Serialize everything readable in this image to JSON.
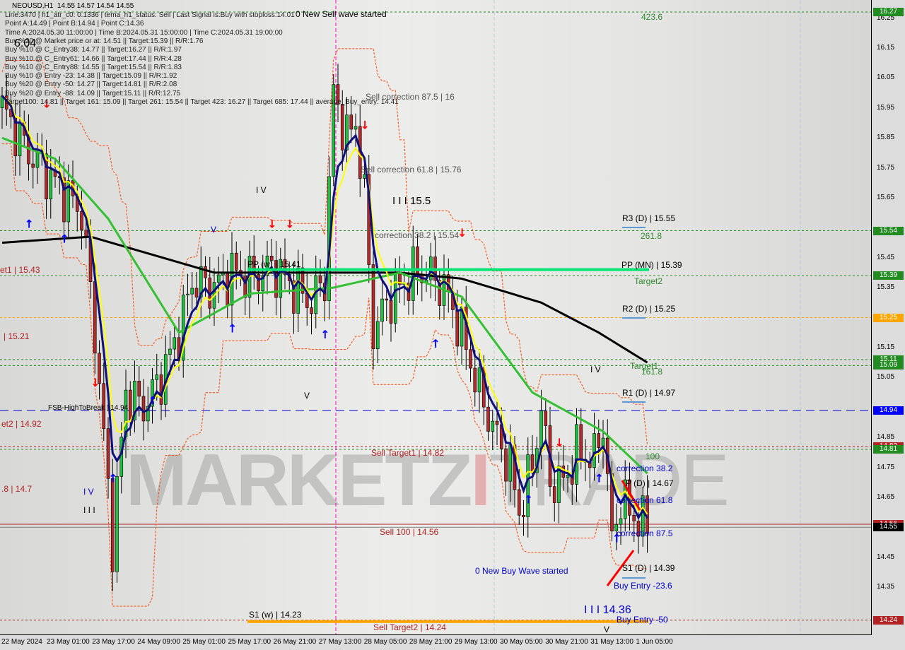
{
  "header": {
    "symbol": "NEOUSD,H1",
    "ohlc": "14.55 14.57 14.54 14.55"
  },
  "info_lines": [
    "Line:3470 | h1_atr_c0: 0.1336 | tema_h1_status: Sell | Last Signal is:Buy with stoploss:14.01",
    "Point A:14.49 | Point B:14.94 | Point C:14.36",
    "Time A:2024.05.30 11:00:00 | Time B:2024.05.31 15:00:00 | Time C:2024.05.31 19:00:00",
    "Buy %20 @ Market price or at: 14.51 || Target:15.39 || R/R:1.76",
    "Buy %10 @ C_Entry38: 14.77 || Target:16.27 || R/R:1.97",
    "Buy %10 @ C_Entry61: 14.66 || Target:17.44 || R/R:4.28",
    "Buy %10 @ C_Entry88: 14.55 || Target:15.54 || R/R:1.83",
    "Buy %10 @ Entry -23: 14.38 || Target:15.09 || R/R:1.92",
    "Buy %20 @ Entry -50: 14.27 || Target:14.81 || R/R:2.08",
    "Buy %20 @ Entry -88: 14.09 || Target:15.11 || R/R:12.75",
    "Target100: 14.81 || Target 161: 15.09 || Target 261: 15.54 || Target 423: 16.27 || Target 685: 17.44 || average_Buy_entry: 14.41"
  ],
  "watermark": {
    "bold": "MARKETZ",
    "thin": "TRADE",
    "mid": "I"
  },
  "colors": {
    "bull": "#1fbf3f",
    "bear": "#b22a2a",
    "ma_black": "#000000",
    "ma_green": "#33c033",
    "ma_navy": "#10107a",
    "ma_yellow": "#ffff00",
    "pp_line": "#00e676",
    "channel": "#ff4500"
  },
  "chart_data": {
    "type": "candlestick",
    "timeframe": "H1",
    "ylim": [
      14.22,
      16.31
    ],
    "yticks": [
      16.25,
      16.15,
      16.05,
      15.95,
      15.85,
      15.75,
      15.65,
      15.45,
      15.35,
      15.15,
      15.05,
      14.85,
      14.75,
      14.65,
      14.45,
      14.35
    ],
    "xticks": [
      "22 May 2024",
      "23 May 01:00",
      "23 May 17:00",
      "24 May 09:00",
      "25 May 01:00",
      "25 May 17:00",
      "26 May 21:00",
      "27 May 13:00",
      "28 May 05:00",
      "28 May 21:00",
      "29 May 13:00",
      "30 May 05:00",
      "30 May 21:00",
      "31 May 13:00",
      "1 Jun 05:00"
    ],
    "close_path": [
      [
        0,
        15.95
      ],
      [
        6,
        15.8
      ],
      [
        12,
        15.7
      ],
      [
        18,
        15.6
      ],
      [
        21,
        15.2
      ],
      [
        23,
        14.85
      ],
      [
        25,
        14.5
      ],
      [
        28,
        15.0
      ],
      [
        32,
        14.95
      ],
      [
        36,
        15.05
      ],
      [
        40,
        15.2
      ],
      [
        43,
        15.37
      ],
      [
        48,
        15.35
      ],
      [
        52,
        15.4
      ],
      [
        57,
        15.38
      ],
      [
        61,
        15.42
      ],
      [
        66,
        15.35
      ],
      [
        70,
        15.3
      ],
      [
        73,
        15.38
      ],
      [
        75,
        16.0
      ],
      [
        78,
        15.85
      ],
      [
        80,
        15.9
      ],
      [
        82,
        15.65
      ],
      [
        84,
        15.2
      ],
      [
        87,
        15.3
      ],
      [
        90,
        15.35
      ],
      [
        93,
        15.4
      ],
      [
        96,
        15.4
      ],
      [
        100,
        15.35
      ],
      [
        104,
        15.2
      ],
      [
        108,
        15.0
      ],
      [
        112,
        14.85
      ],
      [
        115,
        14.75
      ],
      [
        117,
        14.6
      ],
      [
        120,
        14.75
      ],
      [
        122,
        14.95
      ],
      [
        124,
        14.7
      ],
      [
        127,
        14.7
      ],
      [
        130,
        14.8
      ],
      [
        134,
        14.78
      ],
      [
        136,
        14.9
      ],
      [
        138,
        14.5
      ],
      [
        140,
        14.65
      ],
      [
        142,
        14.6
      ],
      [
        145,
        14.56
      ]
    ],
    "ma_black": [
      [
        0,
        15.5
      ],
      [
        20,
        15.52
      ],
      [
        48,
        15.4
      ],
      [
        90,
        15.4
      ],
      [
        104,
        15.38
      ],
      [
        122,
        15.3
      ],
      [
        135,
        15.2
      ],
      [
        146,
        15.1
      ]
    ],
    "ma_green": [
      [
        0,
        15.85
      ],
      [
        12,
        15.78
      ],
      [
        24,
        15.58
      ],
      [
        40,
        15.2
      ],
      [
        56,
        15.33
      ],
      [
        75,
        15.35
      ],
      [
        90,
        15.4
      ],
      [
        104,
        15.32
      ],
      [
        120,
        15.0
      ],
      [
        136,
        14.87
      ],
      [
        146,
        14.73
      ]
    ],
    "horizontal_levels": [
      {
        "price": 16.27,
        "color": "#228b22",
        "style": "dash",
        "tag": "16.27"
      },
      {
        "price": 15.54,
        "color": "#228b22",
        "style": "dash",
        "tag": "15.54"
      },
      {
        "price": 15.39,
        "color": "#228b22",
        "style": "dash",
        "tag": "15.39"
      },
      {
        "price": 15.25,
        "color": "#ffa500",
        "style": "dash",
        "tag": "15.25"
      },
      {
        "price": 15.11,
        "color": "#228b22",
        "style": "dash",
        "tag": "15.11"
      },
      {
        "price": 15.09,
        "color": "#228b22",
        "style": "dash",
        "tag": "15.09"
      },
      {
        "price": 14.94,
        "color": "#0000cd",
        "style": "longdash",
        "tag": "14.94"
      },
      {
        "price": 14.82,
        "color": "#b22222",
        "style": "dash",
        "tag": "14.82"
      },
      {
        "price": 14.81,
        "color": "#228b22",
        "style": "dash",
        "tag": "14.81"
      },
      {
        "price": 14.56,
        "color": "#b22222",
        "style": "solid",
        "tag": "14.56"
      },
      {
        "price": 14.55,
        "color": "#808080",
        "style": "solid",
        "tag": "14.55"
      },
      {
        "price": 14.24,
        "color": "#b22222",
        "style": "dash",
        "tag": "14.24"
      }
    ],
    "tag_colors": {
      "16.27": "#228b22",
      "15.54": "#228b22",
      "15.39": "#228b22",
      "15.25": "#ffa500",
      "15.11": "#228b22",
      "15.09": "#228b22",
      "14.94": "#0000ff",
      "14.82": "#b22222",
      "14.81": "#228b22",
      "14.56": "#b22222",
      "14.55": "#000000",
      "14.24": "#b22222"
    },
    "pp_monthly": 15.41,
    "sell_target2": 14.24,
    "annotations": [
      {
        "text": "0 New Sell wave started",
        "color": "#000000"
      },
      {
        "text": "423.6",
        "color": "#2e8b2e"
      },
      {
        "text": "Sell correction 87.5 | 16",
        "color": "#555555"
      },
      {
        "text": "Sell correction 61.8 | 15.76",
        "color": "#555555"
      },
      {
        "text": "I I I 15.5",
        "color": "#000000"
      },
      {
        "text": "I V",
        "color": "#000000"
      },
      {
        "text": "correction 38.2 | 15.54",
        "color": "#555555"
      },
      {
        "text": "R3 (D) | 15.55",
        "color": "#000000"
      },
      {
        "text": "261.8",
        "color": "#2e8b2e"
      },
      {
        "text": "PP (MN) | 15.39",
        "color": "#000000"
      },
      {
        "text": "Target2",
        "color": "#2e8b2e"
      },
      {
        "text": "R2 (D) | 15.25",
        "color": "#000000"
      },
      {
        "text": "Target1",
        "color": "#2e8b2e"
      },
      {
        "text": "161.8",
        "color": "#2e8b2e"
      },
      {
        "text": "R1 (D) | 14.97",
        "color": "#000000"
      },
      {
        "text": "I V",
        "color": "#000000"
      },
      {
        "text": "PP (w) | 15.41",
        "color": "#000000"
      },
      {
        "text": "et1 | 15.43",
        "color": "#b22222"
      },
      {
        "text": "| 15.21",
        "color": "#b22222"
      },
      {
        "text": "FSB-HighToBreak | 14.94",
        "color": "#000000"
      },
      {
        "text": "et2 | 14.92",
        "color": "#b22222"
      },
      {
        "text": "Sell Target1 | 14.82",
        "color": "#b22222"
      },
      {
        "text": "100",
        "color": "#2e8b2e"
      },
      {
        "text": "correction 38.2",
        "color": "#0000cd"
      },
      {
        "text": "P (D) | 14.67",
        "color": "#000000"
      },
      {
        "text": "correction 61.8",
        "color": "#0000cd"
      },
      {
        "text": ".8 | 14.7",
        "color": "#b22222"
      },
      {
        "text": "I V",
        "color": "#0000cd"
      },
      {
        "text": "I I I",
        "color": "#000000"
      },
      {
        "text": "Sell 100 | 14.56",
        "color": "#b22222"
      },
      {
        "text": "correction 87.5",
        "color": "#0000cd"
      },
      {
        "text": "0 New Buy Wave started",
        "color": "#0000cd"
      },
      {
        "text": "S1 (D) | 14.39",
        "color": "#000000"
      },
      {
        "text": "Buy Entry -23.6",
        "color": "#0000cd"
      },
      {
        "text": "I I I 14.36",
        "color": "#0000cd"
      },
      {
        "text": "Buy Entry -50",
        "color": "#0000cd"
      },
      {
        "text": "S1 (w) | 14.23",
        "color": "#000000"
      },
      {
        "text": "Sell Target2 | 14.24",
        "color": "#b22222"
      },
      {
        "text": "V",
        "color": "#000000"
      },
      {
        "text": "V",
        "color": "#0000cd"
      },
      {
        "text": "V",
        "color": "#000000"
      },
      {
        "text": "6.04",
        "color": "#000000"
      }
    ],
    "signals": [
      {
        "type": "buy",
        "index": 6,
        "price": 15.55
      },
      {
        "type": "buy",
        "index": 14,
        "price": 15.5
      },
      {
        "type": "sell",
        "index": 10,
        "price": 15.95
      },
      {
        "type": "sell",
        "index": 21,
        "price": 15.02
      },
      {
        "type": "buy",
        "index": 25,
        "price": 14.7
      },
      {
        "type": "buy",
        "index": 34,
        "price": 14.96
      },
      {
        "type": "buy",
        "index": 52,
        "price": 15.2
      },
      {
        "type": "sell",
        "index": 61,
        "price": 15.55
      },
      {
        "type": "sell",
        "index": 65,
        "price": 15.55
      },
      {
        "type": "buy",
        "index": 73,
        "price": 15.18
      },
      {
        "type": "sell",
        "index": 82,
        "price": 15.88
      },
      {
        "type": "sell",
        "index": 104,
        "price": 15.52
      },
      {
        "type": "buy",
        "index": 98,
        "price": 15.15
      },
      {
        "type": "sell",
        "index": 126,
        "price": 14.82
      },
      {
        "type": "buy",
        "index": 119,
        "price": 14.63
      },
      {
        "type": "buy",
        "index": 135,
        "price": 14.7
      },
      {
        "type": "buy",
        "index": 139,
        "price": 14.5
      }
    ]
  }
}
